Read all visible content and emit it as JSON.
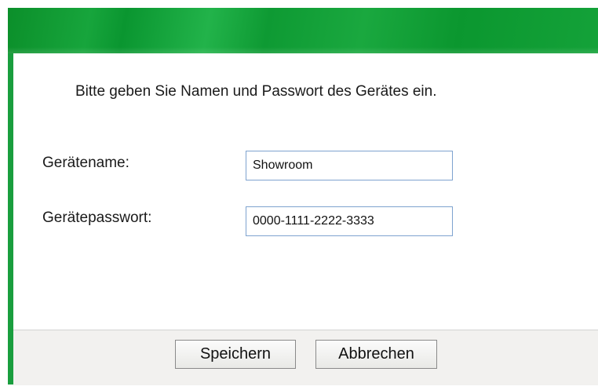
{
  "colors": {
    "title_bar": "#14a239",
    "left_border": "#1a9e3e",
    "input_border": "#7ea3cf",
    "button_bar": "#f2f1ef"
  },
  "dialog": {
    "instruction": "Bitte geben Sie Namen und Passwort des Gerätes ein."
  },
  "form": {
    "name_label": "Gerätename:",
    "name_value": "Showroom",
    "password_label": "Gerätepasswort:",
    "password_value": "0000-1111-2222-3333"
  },
  "buttons": {
    "save_label": "Speichern",
    "cancel_label": "Abbrechen"
  }
}
